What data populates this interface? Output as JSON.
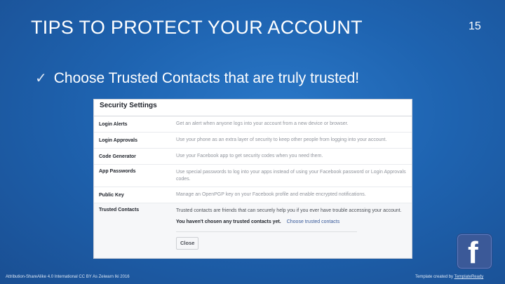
{
  "slide": {
    "title": "TIPS TO PROTECT YOUR ACCOUNT",
    "number": "15",
    "bullet_mark": "✓",
    "bullet": "Choose Trusted Contacts that are truly trusted!"
  },
  "screenshot": {
    "header": "Security Settings",
    "rows": [
      {
        "name": "Login Alerts",
        "desc": "Get an alert when anyone logs into your account from a new device or browser."
      },
      {
        "name": "Login Approvals",
        "desc": "Use your phone as an extra layer of security to keep other people from logging into your account."
      },
      {
        "name": "Code Generator",
        "desc": "Use your Facebook app to get security codes when you need them."
      },
      {
        "name": "App Passwords",
        "desc": "Use special passwords to log into your apps instead of using your Facebook password or Login Approvals codes."
      },
      {
        "name": "Public Key",
        "desc": "Manage an OpenPGP key on your Facebook profile and enable encrypted notifications."
      },
      {
        "name": "Trusted Contacts",
        "desc": "Trusted contacts are friends that can securely help you if you ever have trouble accessing your account."
      }
    ],
    "notice": "You haven't chosen any trusted contacts yet.",
    "choose_link": "Choose trusted contacts",
    "close_button": "Close"
  },
  "logo": {
    "letter": "f"
  },
  "footer": {
    "left": "Attribution-ShareAlike 4.0 International CC BY As Zeiwarn Iki 2016",
    "right_prefix": "Template created by ",
    "right_link": "TemplateReady"
  },
  "colors": {
    "background": "#1e63b0",
    "facebook_blue": "#3b5998",
    "link": "#365899"
  }
}
